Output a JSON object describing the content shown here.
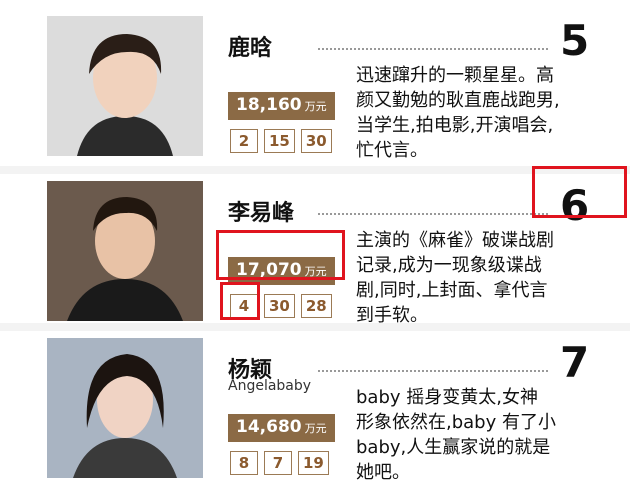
{
  "entries": [
    {
      "name": "鹿晗",
      "subname": "",
      "rank": "5",
      "income_value": "18,160",
      "income_unit": "万元",
      "ranks": [
        "2",
        "15",
        "30"
      ],
      "desc": "迅速蹿升的一颗星星。高\n颜又勤勉的耿直鹿战跑男,\n当学生,拍电影,开演唱会,\n忙代言。"
    },
    {
      "name": "李易峰",
      "subname": "",
      "rank": "6",
      "income_value": "17,070",
      "income_unit": "万元",
      "ranks": [
        "4",
        "30",
        "28"
      ],
      "desc": "主演的《麻雀》破谍战剧\n记录,成为一现象级谍战\n剧,同时,上封面、拿代言\n到手软。"
    },
    {
      "name": "杨颖",
      "subname": "Angelababy",
      "rank": "7",
      "income_value": "14,680",
      "income_unit": "万元",
      "ranks": [
        "8",
        "7",
        "19"
      ],
      "desc": "baby 摇身变黄太,女神\n形象依然在,baby 有了小\nbaby,人生赢家说的就是\n她吧。"
    }
  ],
  "colors": {
    "income_badge": "#8b6a45",
    "rank_box_border": "#9b7a55",
    "highlight": "#e0141e"
  }
}
